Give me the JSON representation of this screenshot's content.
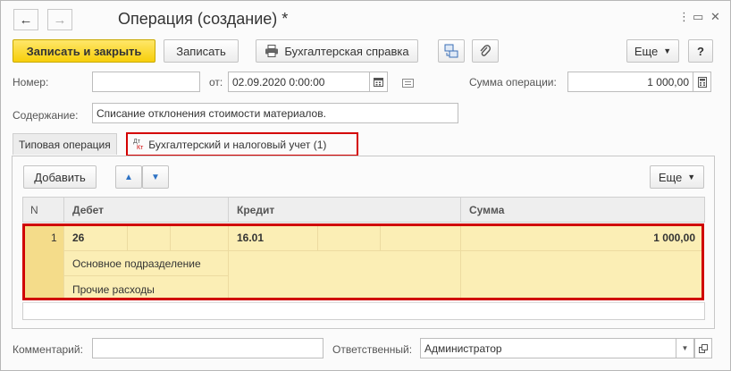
{
  "window": {
    "title": "Операция (создание) *",
    "nav_back": "←",
    "nav_forward": "→",
    "menu_icon": "⋮",
    "restore_icon": "▭",
    "close_icon": "✕"
  },
  "toolbar": {
    "save_close": "Записать и закрыть",
    "save": "Записать",
    "report": "Бухгалтерская справка",
    "more": "Еще",
    "help": "?"
  },
  "header": {
    "number_label": "Номер:",
    "number_value": "",
    "date_label": "от:",
    "date_value": "02.09.2020  0:00:00",
    "sum_label": "Сумма операции:",
    "sum_value": "1 000,00",
    "content_label": "Содержание:",
    "content_value": "Списание отклонения стоимости материалов."
  },
  "tabs": [
    {
      "label": "Типовая операция"
    },
    {
      "label": "Бухгалтерский и налоговый учет (1)",
      "icon_top": "Дт",
      "icon_bottom": "Кт"
    }
  ],
  "table_toolbar": {
    "add": "Добавить",
    "up": "▲",
    "down": "▼",
    "more": "Еще"
  },
  "table": {
    "columns": [
      "N",
      "Дебет",
      "Кредит",
      "Сумма"
    ],
    "rows": [
      {
        "n": "1",
        "debit_account": "26",
        "debit_subconto_1": "Основное подразделение",
        "debit_subconto_2": "Прочие расходы",
        "credit_account": "16.01",
        "amount": "1 000,00"
      }
    ]
  },
  "footer": {
    "comment_label": "Комментарий:",
    "comment_value": "",
    "responsible_label": "Ответственный:",
    "responsible_value": "Администратор"
  },
  "colors": {
    "primary_button": "#f7cf0a",
    "highlight_frame": "#d00000",
    "row_background": "#fbeeb5"
  }
}
